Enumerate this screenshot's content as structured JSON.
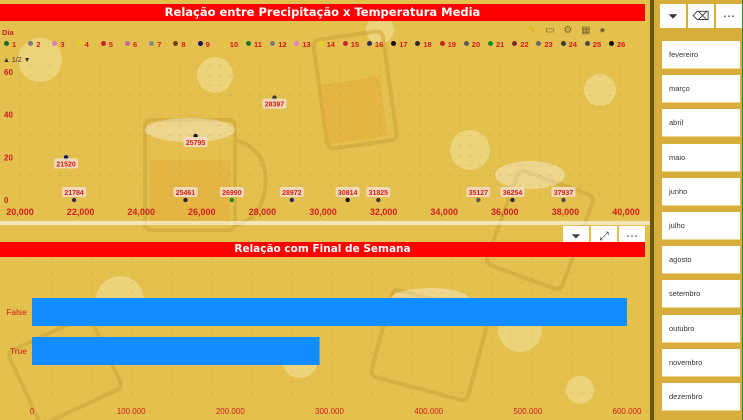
{
  "scatter": {
    "title": "Relação entre Precipitação x Temperatura Media",
    "legend_title": "Dia",
    "pager": "1/2",
    "legend_items": [
      {
        "label": "1",
        "color": "#1a6b2a"
      },
      {
        "label": "2",
        "color": "#7a7a7a"
      },
      {
        "label": "3",
        "color": "#e07ad0"
      },
      {
        "label": "4",
        "color": "#e8d020"
      },
      {
        "label": "5",
        "color": "#c8252e"
      },
      {
        "label": "6",
        "color": "#c86aa8"
      },
      {
        "label": "7",
        "color": "#8a8a8a"
      },
      {
        "label": "8",
        "color": "#7a3a10"
      },
      {
        "label": "9",
        "color": "#101060"
      },
      {
        "label": "10",
        "color": "#e8c838"
      },
      {
        "label": "11",
        "color": "#1a7a2a"
      },
      {
        "label": "12",
        "color": "#7a7a7a"
      },
      {
        "label": "13",
        "color": "#e080d8"
      },
      {
        "label": "14",
        "color": "#e8d020"
      },
      {
        "label": "15",
        "color": "#c8252e"
      },
      {
        "label": "16",
        "color": "#303060"
      },
      {
        "label": "17",
        "color": "#101010"
      },
      {
        "label": "18",
        "color": "#2a2a2a"
      },
      {
        "label": "19",
        "color": "#c82020"
      },
      {
        "label": "20",
        "color": "#5a5a5a"
      },
      {
        "label": "21",
        "color": "#1a8a2a"
      },
      {
        "label": "22",
        "color": "#7a2a2a"
      },
      {
        "label": "23",
        "color": "#6a6a6a"
      },
      {
        "label": "24",
        "color": "#3a3a3a"
      },
      {
        "label": "25",
        "color": "#4a4a4a"
      },
      {
        "label": "26",
        "color": "#101010"
      }
    ],
    "icons": [
      "pencil-icon",
      "comment-icon",
      "gear-icon",
      "grid-icon",
      "info-icon"
    ]
  },
  "chart_data": [
    {
      "type": "scatter",
      "title": "Relação entre Precipitação x Temperatura Media",
      "xlabel": "",
      "ylabel": "",
      "xlim": [
        20000,
        40000
      ],
      "ylim": [
        0,
        60
      ],
      "x_ticks": [
        "20,000",
        "22,000",
        "24,000",
        "26,000",
        "28,000",
        "30,000",
        "32,000",
        "34,000",
        "36,000",
        "38,000",
        "40,000"
      ],
      "y_ticks": [
        "0",
        "20",
        "40",
        "60"
      ],
      "points": [
        {
          "x": 21520,
          "y": 20,
          "label": "21520"
        },
        {
          "x": 21784,
          "y": 0,
          "label": "21784"
        },
        {
          "x": 25461,
          "y": 0,
          "label": "25461"
        },
        {
          "x": 25795,
          "y": 30,
          "label": "25795"
        },
        {
          "x": 26990,
          "y": 0,
          "label": "26990"
        },
        {
          "x": 28397,
          "y": 48,
          "label": "28397"
        },
        {
          "x": 28972,
          "y": 0,
          "label": "28972"
        },
        {
          "x": 30814,
          "y": 0,
          "label": "30814"
        },
        {
          "x": 31825,
          "y": 0,
          "label": "31825"
        },
        {
          "x": 35127,
          "y": 0,
          "label": "35127"
        },
        {
          "x": 36254,
          "y": 0,
          "label": "36254"
        },
        {
          "x": 37937,
          "y": 0,
          "label": "37937"
        }
      ]
    },
    {
      "type": "bar",
      "title": "Relação com Final de Semana",
      "orientation": "horizontal",
      "categories": [
        "False",
        "True"
      ],
      "values": [
        600000,
        290000
      ],
      "xlim": [
        0,
        600000
      ],
      "x_ticks": [
        "0",
        "100.000",
        "200.000",
        "300.000",
        "400.000",
        "500.000",
        "600.000"
      ],
      "colors": [
        "#118dff"
      ]
    }
  ],
  "bar": {
    "title": "Relação com Final de Semana",
    "header_icons": [
      "filter-icon",
      "expand-icon",
      "more-options-icon"
    ]
  },
  "slicer": {
    "top_icons": [
      "filter-icon",
      "eraser-icon",
      "more-options-icon"
    ],
    "months": [
      "fevereiro",
      "março",
      "abril",
      "maio",
      "junho",
      "julho",
      "agosto",
      "setembro",
      "outubro",
      "novembro",
      "dezembro"
    ]
  }
}
